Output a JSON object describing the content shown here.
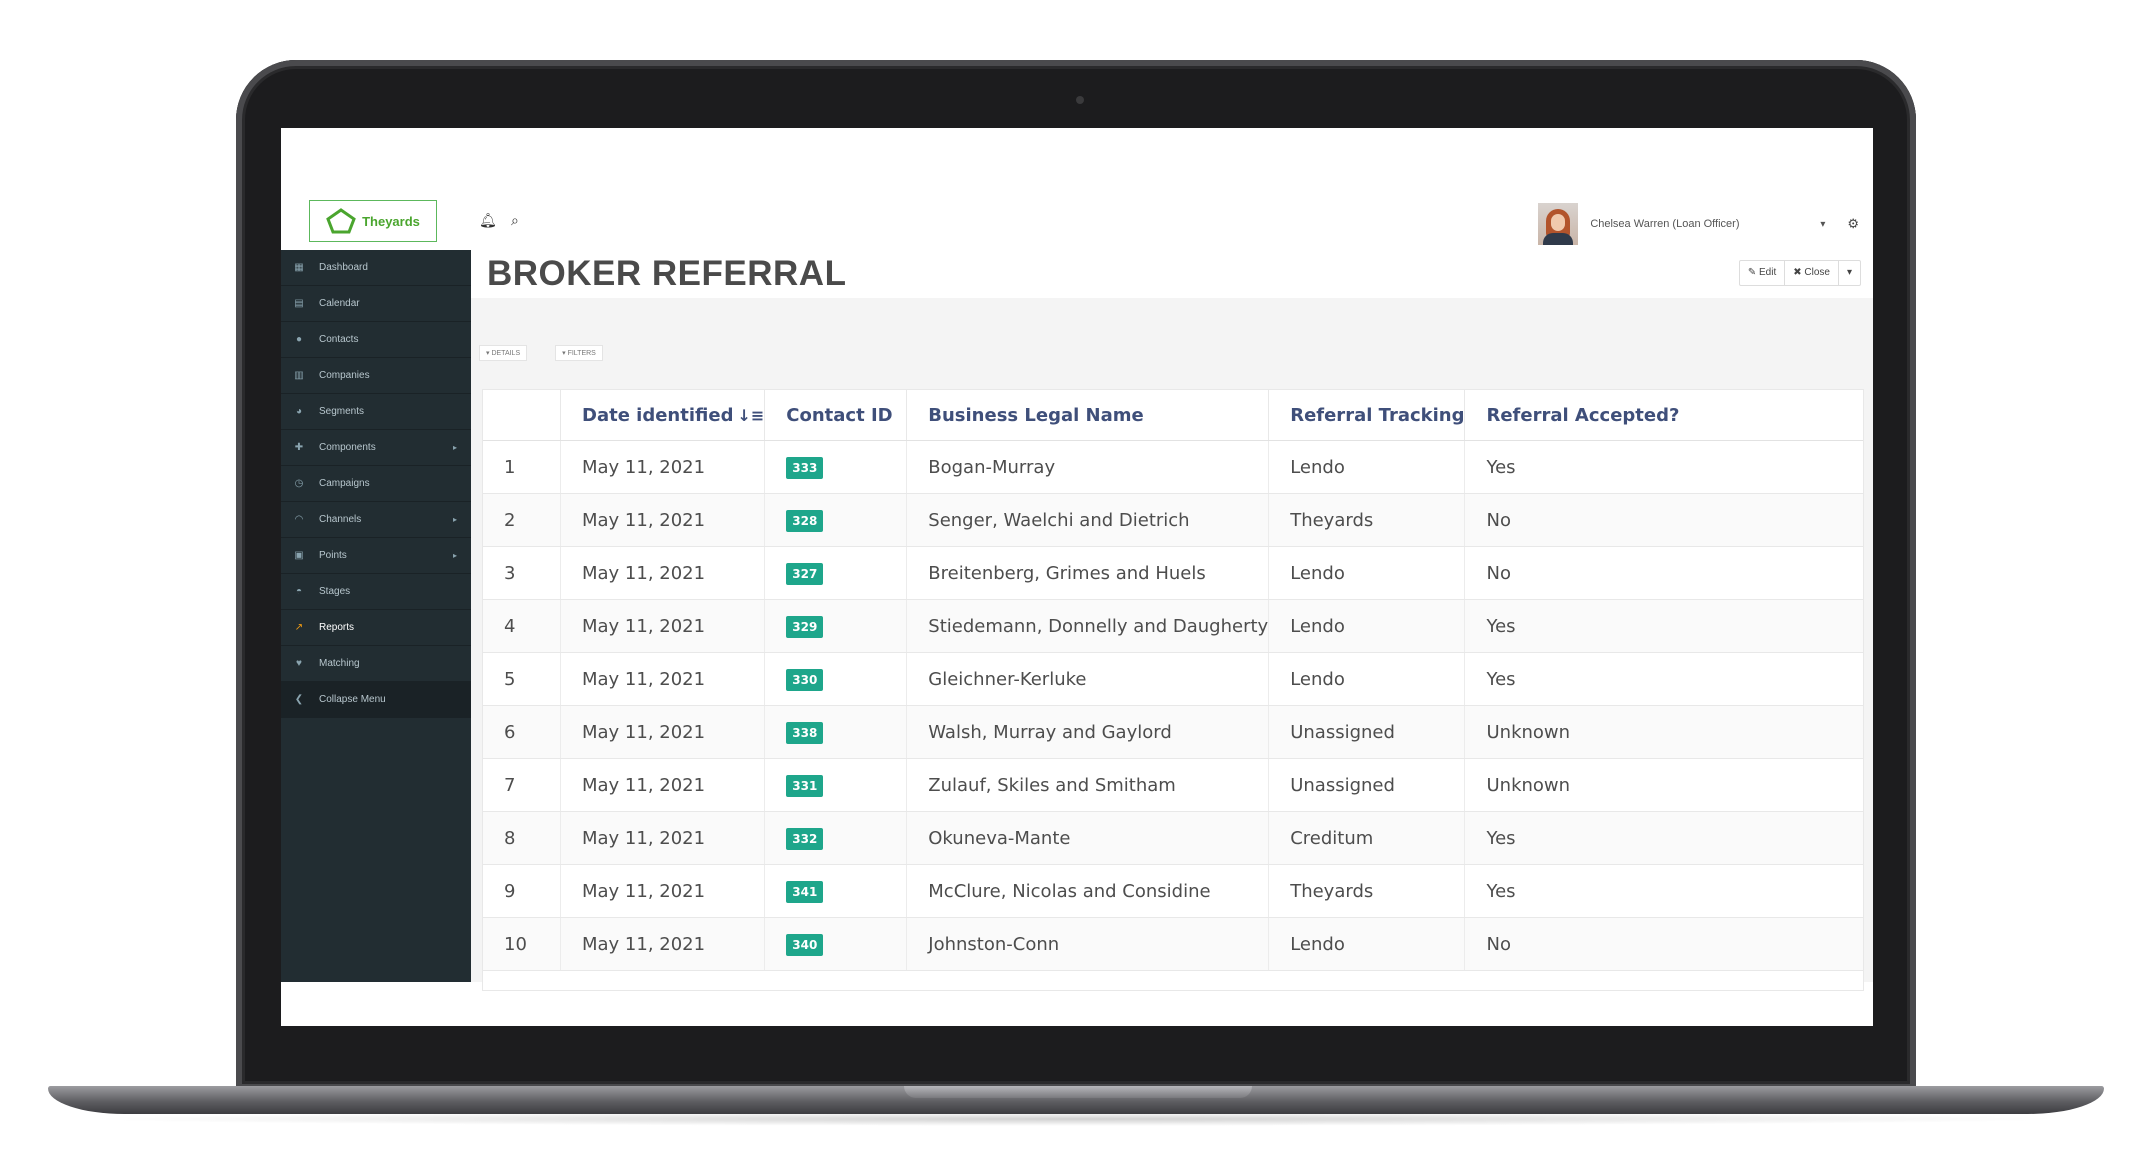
{
  "app": {
    "logo_text": "Theyards"
  },
  "user": {
    "name": "Chelsea Warren (Loan Officer)"
  },
  "sidebar": {
    "items": [
      {
        "label": "Dashboard",
        "icon": "dashboard-icon",
        "glyph": "▦",
        "chev": ""
      },
      {
        "label": "Calendar",
        "icon": "calendar-icon",
        "glyph": "▤",
        "chev": ""
      },
      {
        "label": "Contacts",
        "icon": "user-icon",
        "glyph": "●",
        "chev": ""
      },
      {
        "label": "Companies",
        "icon": "building-icon",
        "glyph": "▥",
        "chev": ""
      },
      {
        "label": "Segments",
        "icon": "pie-chart-icon",
        "glyph": "◕",
        "chev": ""
      },
      {
        "label": "Components",
        "icon": "puzzle-icon",
        "glyph": "✚",
        "chev": "▸"
      },
      {
        "label": "Campaigns",
        "icon": "clock-icon",
        "glyph": "◷",
        "chev": ""
      },
      {
        "label": "Channels",
        "icon": "rss-icon",
        "glyph": "◠",
        "chev": "▸"
      },
      {
        "label": "Points",
        "icon": "calculator-icon",
        "glyph": "▣",
        "chev": "▸"
      },
      {
        "label": "Stages",
        "icon": "gauge-icon",
        "glyph": "◓",
        "chev": ""
      },
      {
        "label": "Reports",
        "icon": "line-chart-icon",
        "glyph": "↗",
        "chev": ""
      },
      {
        "label": "Matching",
        "icon": "heart-icon",
        "glyph": "♥",
        "chev": ""
      }
    ],
    "collapse_label": "Collapse Menu"
  },
  "page": {
    "title": "BROKER REFERRAL",
    "edit_label": "Edit",
    "close_label": "Close",
    "tab_details": "▾ DETAILS",
    "tab_filters": "▾ FILTERS"
  },
  "table": {
    "headers": [
      "",
      "Date identified",
      "Contact ID",
      "Business Legal Name",
      "Referral Tracking",
      "Referral Accepted?"
    ],
    "rows": [
      {
        "num": "1",
        "date": "May 11, 2021",
        "id": "333",
        "name": "Bogan-Murray",
        "tracking": "Lendo",
        "accepted": "Yes"
      },
      {
        "num": "2",
        "date": "May 11, 2021",
        "id": "328",
        "name": "Senger, Waelchi and Dietrich",
        "tracking": "Theyards",
        "accepted": "No"
      },
      {
        "num": "3",
        "date": "May 11, 2021",
        "id": "327",
        "name": "Breitenberg, Grimes and Huels",
        "tracking": "Lendo",
        "accepted": "No"
      },
      {
        "num": "4",
        "date": "May 11, 2021",
        "id": "329",
        "name": "Stiedemann, Donnelly and Daugherty",
        "tracking": "Lendo",
        "accepted": "Yes"
      },
      {
        "num": "5",
        "date": "May 11, 2021",
        "id": "330",
        "name": "Gleichner-Kerluke",
        "tracking": "Lendo",
        "accepted": "Yes"
      },
      {
        "num": "6",
        "date": "May 11, 2021",
        "id": "338",
        "name": "Walsh, Murray and Gaylord",
        "tracking": "Unassigned",
        "accepted": "Unknown"
      },
      {
        "num": "7",
        "date": "May 11, 2021",
        "id": "331",
        "name": "Zulauf, Skiles and Smitham",
        "tracking": "Unassigned",
        "accepted": "Unknown"
      },
      {
        "num": "8",
        "date": "May 11, 2021",
        "id": "332",
        "name": "Okuneva-Mante",
        "tracking": "Creditum",
        "accepted": "Yes"
      },
      {
        "num": "9",
        "date": "May 11, 2021",
        "id": "341",
        "name": "McClure, Nicolas and Considine",
        "tracking": "Theyards",
        "accepted": "Yes"
      },
      {
        "num": "10",
        "date": "May 11, 2021",
        "id": "340",
        "name": "Johnston-Conn",
        "tracking": "Lendo",
        "accepted": "No"
      }
    ]
  },
  "colors": {
    "sidebar_bg": "#222d32",
    "badge": "#1ea68b",
    "header_text": "#3f4f7a",
    "logo_green": "#4aa52e"
  }
}
